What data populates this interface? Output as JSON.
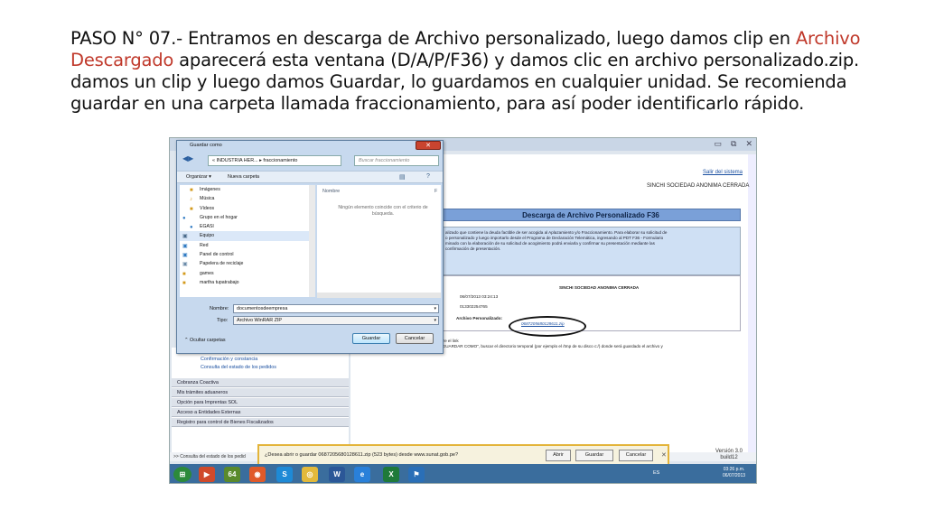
{
  "slide": {
    "paso": "PASO N° 07",
    "part1": ".- Entramos en descarga de Archivo personalizado, luego damos clip en ",
    "highlight": "Archivo Descargado",
    "part2": " aparecerá esta ventana (D/A/P/F36) y damos clic en archivo personalizado.zip. damos un clip y luego damos Guardar, lo guardamos en cualquier unidad. Se recomienda guardar en una carpeta llamada fraccionamiento, para así poder identificarlo rápido.",
    "highlight_color": "#c0392b"
  },
  "browser": {
    "logout_link": "Salir del sistema",
    "company": "SINCHI SOCIEDAD ANONIMA CERRADA",
    "banner_title": "Descarga de Archivo Personalizado F36",
    "info_lines": [
      "alizado que contiene la deuda factible de ser acogida al Aplazamiento y/o Fraccionamiento. Para elaborar su solicitud de",
      "o personalizado y luego importarlo desde el Programa de Declaración Telemática, ingresando al PDT F36 - Formulario",
      "minado con la elaboración de su solicitud de acogimiento podrá enviarla y confirmar su presentación mediante las",
      "confirmación de presentación."
    ],
    "result": {
      "name": "SINCHI SOCIEDAD ANONIMA CERRADA",
      "date": "06/07/2013 03:24:13",
      "ruc": "013302254765",
      "file_label": "Archivo Personalizado:",
      "file_link": "0687205680128611.zip"
    },
    "note_lines": [
      "bre el link",
      "\"GUARDAR COMO\", buscar el directorio temporal (por ejemplo el /tmp de su disco c:/) donde será guardado el archivo y"
    ],
    "tree_items": [
      "Consulta del estado de la solicitud",
      "Confirmación y constancia",
      "Consulta del estado de los pedidos"
    ],
    "menu_items": [
      "Cobranza Coactiva",
      "Mis trámites aduaneros",
      "Opción para Imprentas SOL",
      "Acceso a Entidades Externas",
      "Registro para control de Bienes Fiscalizados"
    ],
    "status_text": ">> Consulta del estado de los pedid",
    "version_line1": "Versión 3.0",
    "version_line2": "build12"
  },
  "download_bar": {
    "question": "¿Desea abrir o guardar 0687205680128611.zip (523 bytes) desde www.sunat.gob.pe?",
    "open": "Abrir",
    "save": "Guardar",
    "cancel": "Cancelar"
  },
  "taskbar": {
    "lang": "ES",
    "time": "03:26 p.m.",
    "date": "06/07/2013"
  },
  "dialog": {
    "title": "Guardar como",
    "path": "« INDUSTRIA HER... ▸ fraccionamiento",
    "search_placeholder": "Buscar fraccionamiento",
    "organize": "Organizar ▾",
    "new_folder": "Nueva carpeta",
    "nav_items": [
      "Imágenes",
      "Música",
      "Vídeos",
      "Grupo en el hogar",
      "EGASI",
      "Equipo",
      "Red",
      "Panel de control",
      "Papelera de reciclaje",
      "games",
      "martha tupatrabajo"
    ],
    "column_name": "Nombre",
    "column_f": "F",
    "empty_message": "Ningún elemento coincide con el criterio de búsqueda.",
    "filename_label": "Nombre:",
    "filename_value": "documentosdeempresa",
    "type_label": "Tipo:",
    "type_value": "Archivo WinRAR ZIP",
    "hide_folders": "Ocultar carpetas",
    "save": "Guardar",
    "cancel": "Cancelar"
  }
}
